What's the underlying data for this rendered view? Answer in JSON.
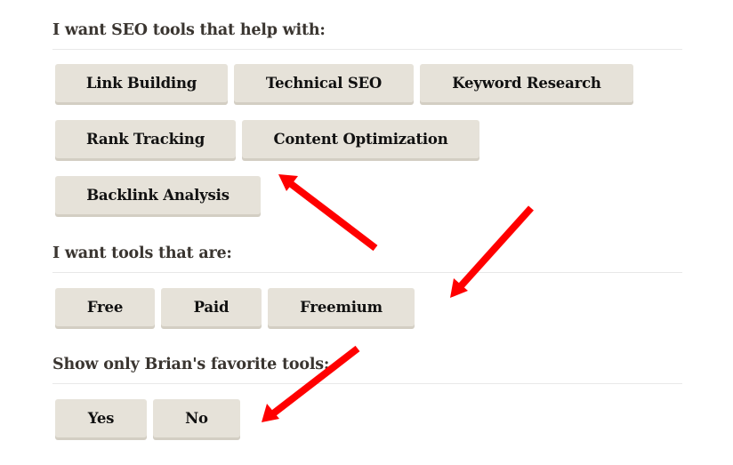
{
  "groups": [
    {
      "heading": "I want SEO tools that help with:",
      "rows": [
        [
          {
            "label": "Link Building"
          },
          {
            "label": "Technical SEO"
          },
          {
            "label": "Keyword Research"
          }
        ],
        [
          {
            "label": "Rank Tracking"
          },
          {
            "label": "Content Optimization"
          }
        ],
        [
          {
            "label": "Backlink Analysis"
          }
        ]
      ]
    },
    {
      "heading": "I want tools that are:",
      "rows": [
        [
          {
            "label": "Free"
          },
          {
            "label": "Paid"
          },
          {
            "label": "Freemium"
          }
        ]
      ]
    },
    {
      "heading": "Show only Brian's favorite tools:",
      "rows": [
        [
          {
            "label": "Yes"
          },
          {
            "label": "No"
          }
        ]
      ]
    }
  ],
  "colors": {
    "button_bg": "#e6e2d9",
    "annotation_arrow": "#ff0000",
    "heading_text": "#3a3530"
  }
}
